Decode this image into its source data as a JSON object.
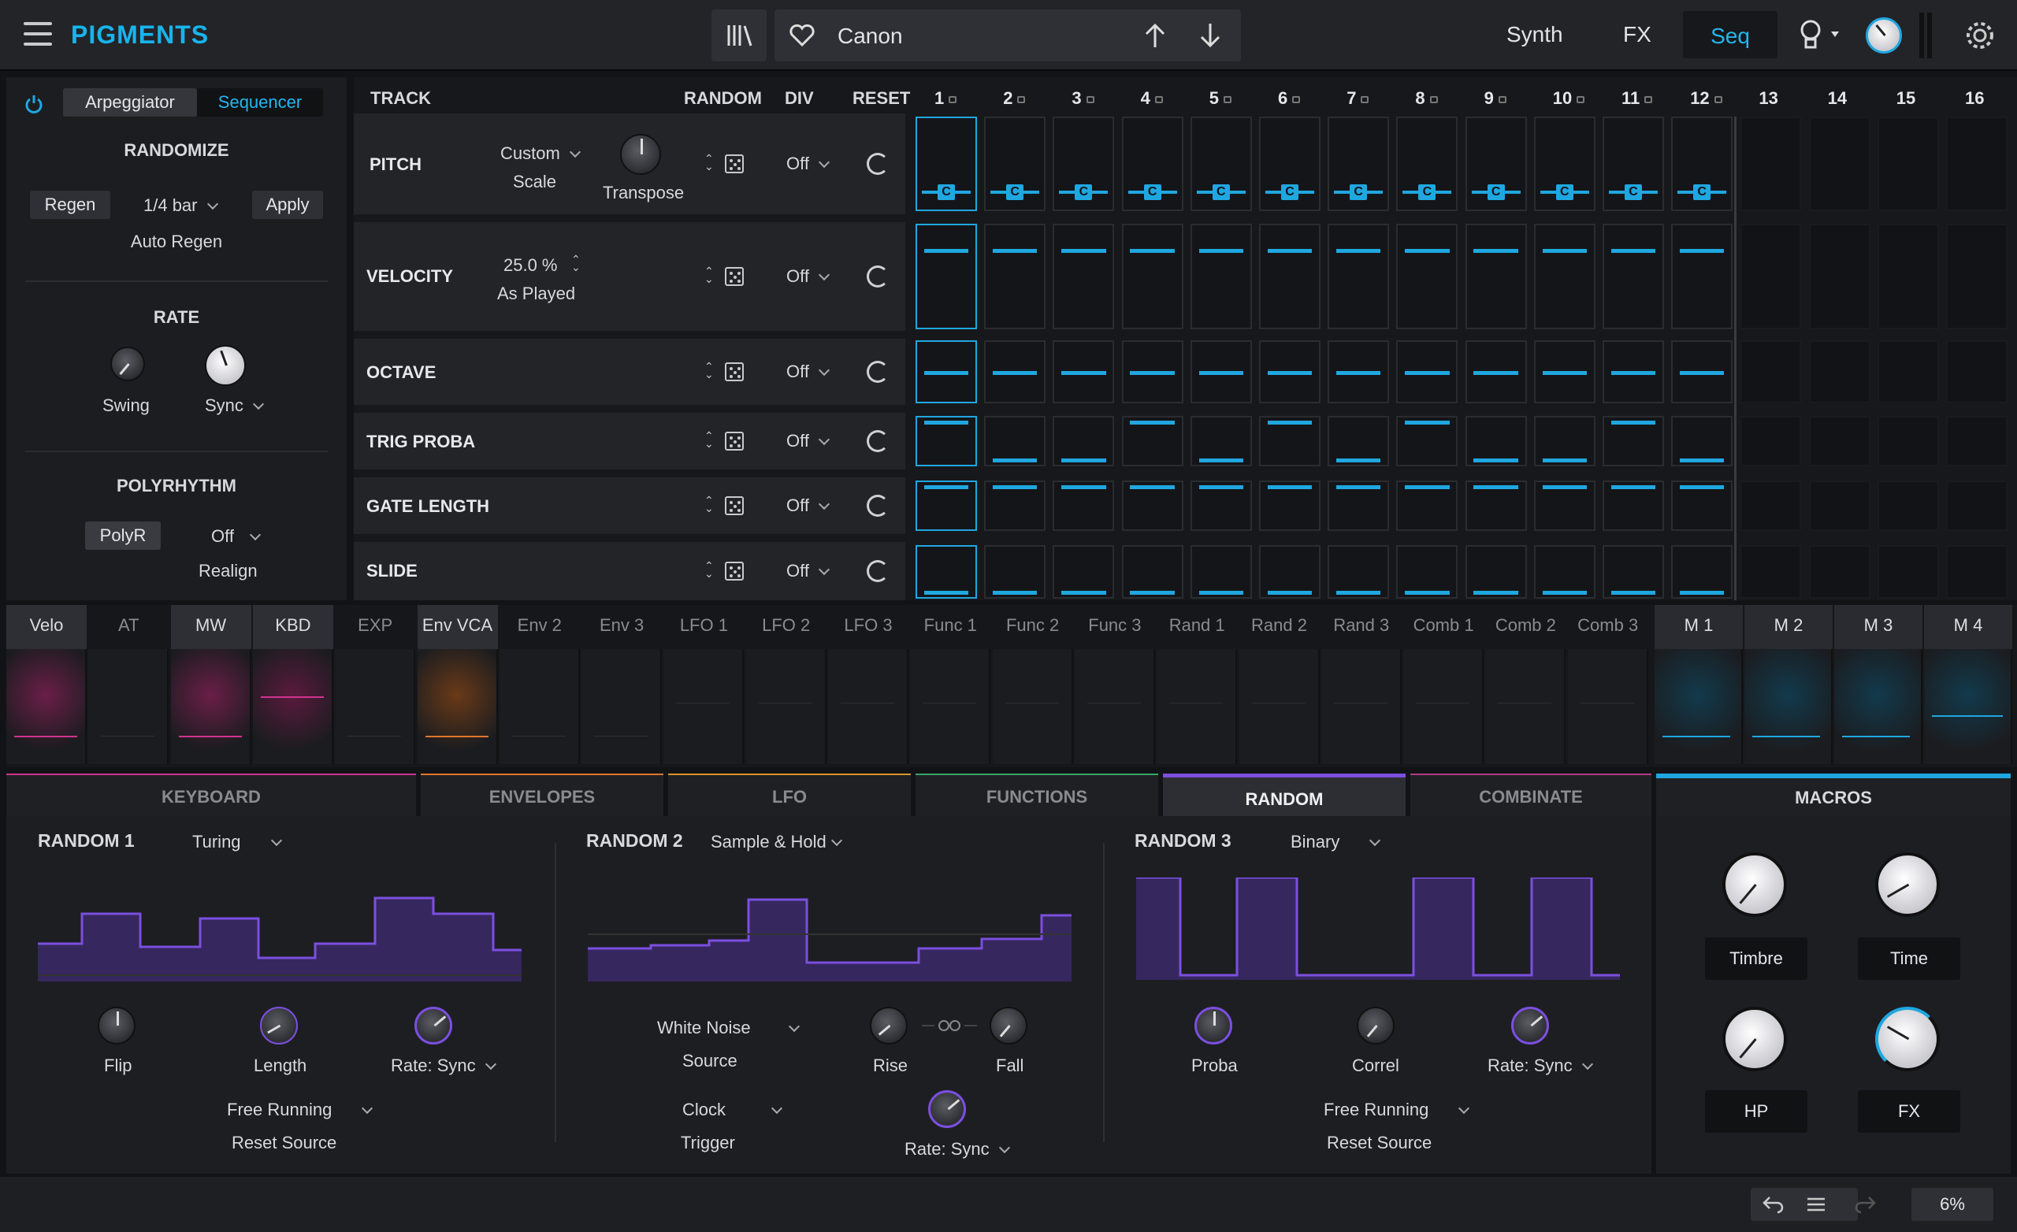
{
  "topbar": {
    "logo": "PIGMENTS",
    "preset_name": "Canon",
    "nav": [
      "Synth",
      "FX",
      "Seq"
    ],
    "active_nav": "Seq"
  },
  "left": {
    "tabs": [
      "Arpeggiator",
      "Sequencer"
    ],
    "active_tab": "Sequencer",
    "randomize_title": "RANDOMIZE",
    "regen": "Regen",
    "rate_value": "1/4 bar",
    "apply": "Apply",
    "auto_regen": "Auto Regen",
    "rate_title": "RATE",
    "swing": "Swing",
    "sync": "Sync",
    "polyrhythm_title": "POLYRHYTHM",
    "polyr": "PolyR",
    "polyr_value": "Off",
    "realign": "Realign"
  },
  "seq": {
    "headers": {
      "track": "TRACK",
      "random": "RANDOM",
      "div": "DIV",
      "reset": "RESET"
    },
    "steps": [
      "1",
      "2",
      "3",
      "4",
      "5",
      "6",
      "7",
      "8",
      "9",
      "10",
      "11",
      "12",
      "13",
      "14",
      "15",
      "16"
    ],
    "active_steps": 12,
    "pitch": {
      "label": "PITCH",
      "scale_value": "Custom",
      "scale_label": "Scale",
      "transpose": "Transpose",
      "div": "Off",
      "note": "C"
    },
    "velocity": {
      "label": "VELOCITY",
      "value": "25.0 %",
      "mode": "As Played",
      "div": "Off"
    },
    "octave": {
      "label": "OCTAVE",
      "div": "Off"
    },
    "trig_proba": {
      "label": "TRIG PROBA",
      "div": "Off",
      "levels": [
        1,
        0,
        0,
        1,
        0,
        1,
        0,
        1,
        0,
        0,
        1,
        0
      ]
    },
    "gate_length": {
      "label": "GATE LENGTH",
      "div": "Off"
    },
    "slide": {
      "label": "SLIDE",
      "div": "Off"
    }
  },
  "mod_sources": [
    "Velo",
    "AT",
    "MW",
    "KBD",
    "EXP",
    "Env VCA",
    "Env 2",
    "Env 3",
    "LFO 1",
    "LFO 2",
    "LFO 3",
    "Func 1",
    "Func 2",
    "Func 3",
    "Rand 1",
    "Rand 2",
    "Rand 3",
    "Comb 1",
    "Comb 2",
    "Comb 3"
  ],
  "macro_sources": [
    "M 1",
    "M 2",
    "M 3",
    "M 4"
  ],
  "sections": [
    "KEYBOARD",
    "ENVELOPES",
    "LFO",
    "FUNCTIONS",
    "RANDOM",
    "COMBINATE"
  ],
  "active_section": "RANDOM",
  "random1": {
    "title": "RANDOM 1",
    "mode": "Turing",
    "flip": "Flip",
    "length": "Length",
    "rate": "Rate: Sync",
    "reset_value": "Free Running",
    "reset_label": "Reset Source"
  },
  "random2": {
    "title": "RANDOM 2",
    "mode": "Sample & Hold",
    "source_value": "White Noise",
    "source_label": "Source",
    "rise": "Rise",
    "fall": "Fall",
    "trigger_value": "Clock",
    "trigger_label": "Trigger",
    "rate": "Rate: Sync"
  },
  "random3": {
    "title": "RANDOM 3",
    "mode": "Binary",
    "proba": "Proba",
    "correl": "Correl",
    "rate": "Rate: Sync",
    "reset_value": "Free Running",
    "reset_label": "Reset Source"
  },
  "macros": {
    "title": "MACROS",
    "labels": [
      "Timbre",
      "Time",
      "HP",
      "FX"
    ]
  },
  "status": {
    "cpu": "6%"
  },
  "colors": {
    "accent": "#1fa7e0",
    "random": "#7b4fe0",
    "keyboard": "#d0348f",
    "envelopes": "#e0772a",
    "lfo": "#d8952b",
    "functions": "#3aa56a",
    "combinate": "#b03a84"
  }
}
